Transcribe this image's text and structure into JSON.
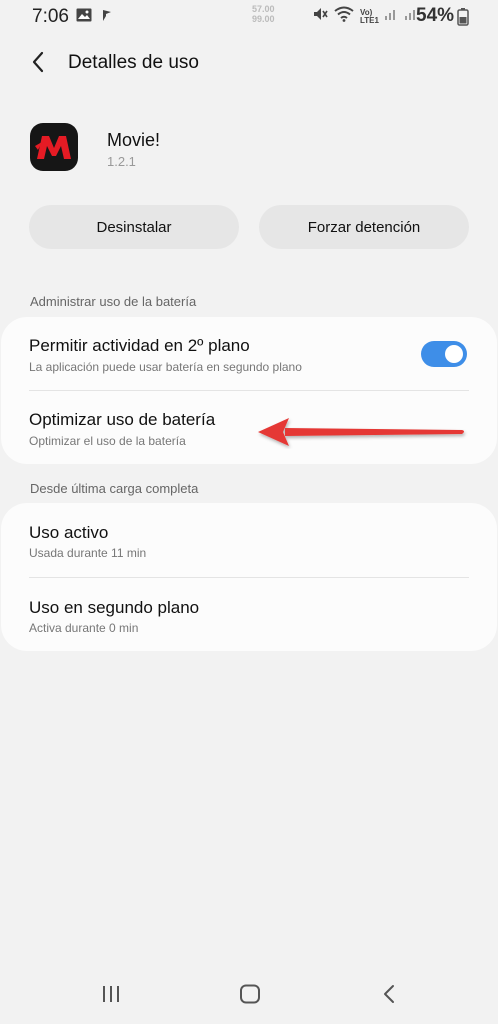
{
  "status_bar": {
    "time": "7:06",
    "speed_up": "57.00",
    "speed_down": "99.00",
    "volte_label": "Vo) LTE1",
    "battery_percent": "54%"
  },
  "header": {
    "title": "Detalles de uso"
  },
  "app": {
    "name": "Movie!",
    "version": "1.2.1"
  },
  "buttons": {
    "uninstall": "Desinstalar",
    "force_stop": "Forzar detención"
  },
  "battery_section": {
    "label": "Administrar uso de la batería",
    "background": {
      "title": "Permitir actividad en 2º plano",
      "subtitle": "La aplicación puede usar batería en segundo plano",
      "toggle_on": true
    },
    "optimize": {
      "title": "Optimizar uso de batería",
      "subtitle": "Optimizar el uso de la batería"
    }
  },
  "since_section": {
    "label": "Desde última carga completa",
    "active": {
      "title": "Uso activo",
      "subtitle": "Usada durante 11 min"
    },
    "background": {
      "title": "Uso en segundo plano",
      "subtitle": "Activa durante 0 min"
    }
  },
  "colors": {
    "accent": "#3e8ee8",
    "arrow": "#e53935",
    "background": "#f2f2f2"
  },
  "icons": {
    "back": "chevron-left-icon",
    "app": "movie-app-icon",
    "nav_recents": "recents-icon",
    "nav_home": "home-icon",
    "nav_back": "back-icon"
  }
}
